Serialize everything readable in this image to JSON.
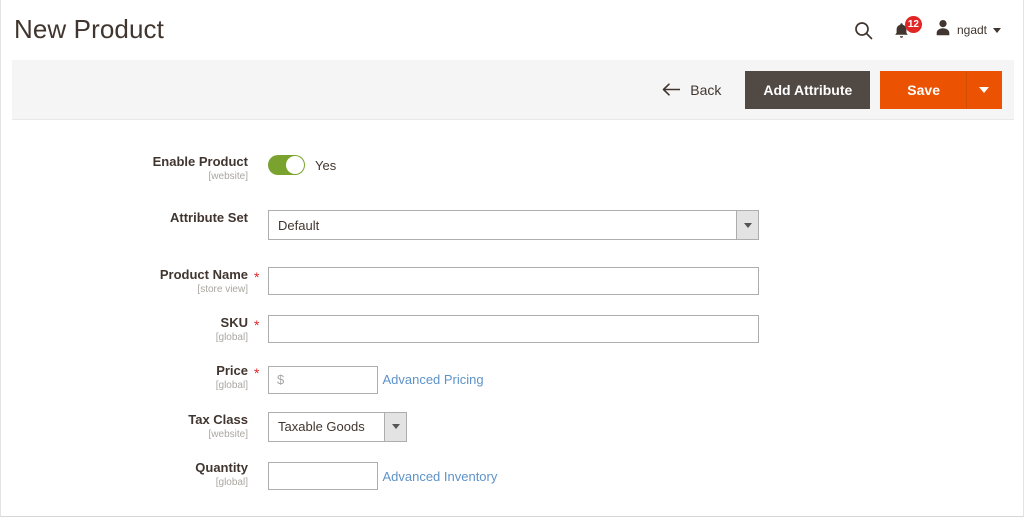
{
  "header": {
    "title": "New Product",
    "search_icon": "search-icon",
    "notifications": {
      "icon": "bell-icon",
      "count": "12",
      "badge_color": "#e22626"
    },
    "user": {
      "avatar_icon": "user-avatar-icon",
      "name": "ngadt",
      "caret_icon": "chevron-down-icon"
    }
  },
  "toolbar": {
    "back_label": "Back",
    "back_icon": "arrow-left-icon",
    "add_attribute_label": "Add Attribute",
    "save_label": "Save",
    "save_menu_icon": "chevron-down-icon",
    "colors": {
      "add_attribute_bg": "#514943",
      "save_bg": "#eb5202"
    }
  },
  "form": {
    "enable_product": {
      "label": "Enable Product",
      "scope": "[website]",
      "toggle_state": "Yes",
      "toggle_color": "#79a22e"
    },
    "attribute_set": {
      "label": "Attribute Set",
      "scope": "",
      "value": "Default"
    },
    "product_name": {
      "label": "Product Name",
      "scope": "[store view]",
      "required": "*",
      "value": "",
      "placeholder": ""
    },
    "sku": {
      "label": "SKU",
      "scope": "[global]",
      "required": "*",
      "value": "",
      "placeholder": ""
    },
    "price": {
      "label": "Price",
      "scope": "[global]",
      "required": "*",
      "value": "",
      "placeholder": "$",
      "advanced_link": "Advanced Pricing"
    },
    "tax_class": {
      "label": "Tax Class",
      "scope": "[website]",
      "value": "Taxable Goods"
    },
    "quantity": {
      "label": "Quantity",
      "scope": "[global]",
      "value": "",
      "placeholder": "",
      "advanced_link": "Advanced Inventory"
    }
  }
}
